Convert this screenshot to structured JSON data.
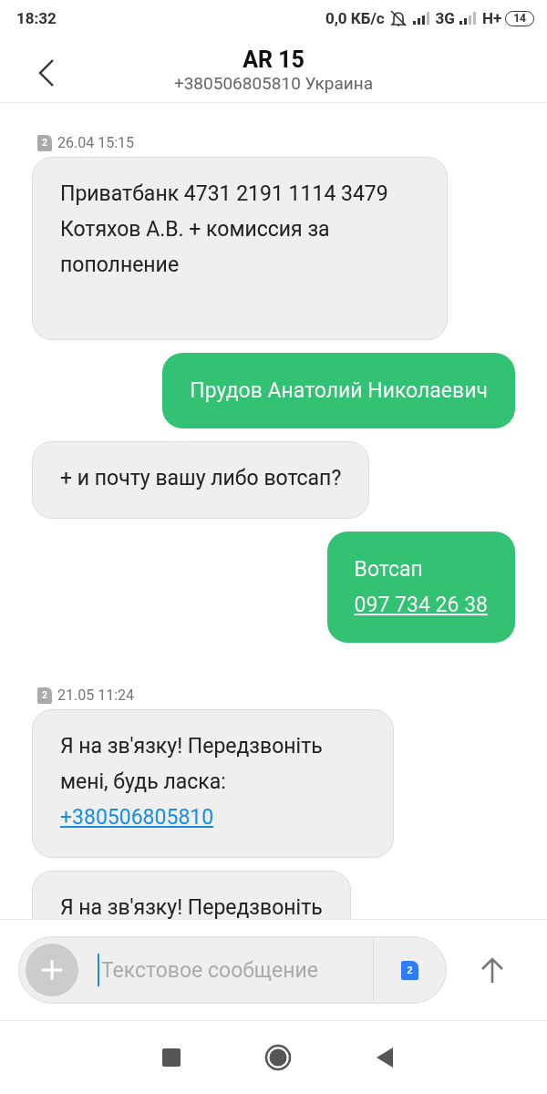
{
  "status_bar": {
    "time": "18:32",
    "speed": "0,0 КБ/с",
    "network_1": "3G",
    "network_2": "H+",
    "battery": "14"
  },
  "header": {
    "title": "AR 15",
    "subtitle": "+380506805810 Украина"
  },
  "messages": [
    {
      "kind": "date",
      "sim": "2",
      "text": "26.04 15:15"
    },
    {
      "kind": "incoming",
      "text": "Приватбанк 4731 2191 1114 3479 Котяхов А.В. + комиссия за пополнение"
    },
    {
      "kind": "outgoing",
      "text": "Прудов Анатолий Николаевич"
    },
    {
      "kind": "incoming",
      "text": "+ и почту вашу либо вотсап?"
    },
    {
      "kind": "outgoing",
      "text": "Вотсап",
      "link": "097 734 26 38"
    },
    {
      "kind": "date",
      "sim": "2",
      "text": "21.05 11:24"
    },
    {
      "kind": "incoming",
      "text": "Я на зв'язку! Передзвоніть мені, будь ласка:",
      "link": "+380506805810"
    },
    {
      "kind": "incoming",
      "text": "Я на зв'язку! Передзвоніть"
    }
  ],
  "composer": {
    "placeholder": "Текстовое сообщение",
    "sim": "2"
  }
}
